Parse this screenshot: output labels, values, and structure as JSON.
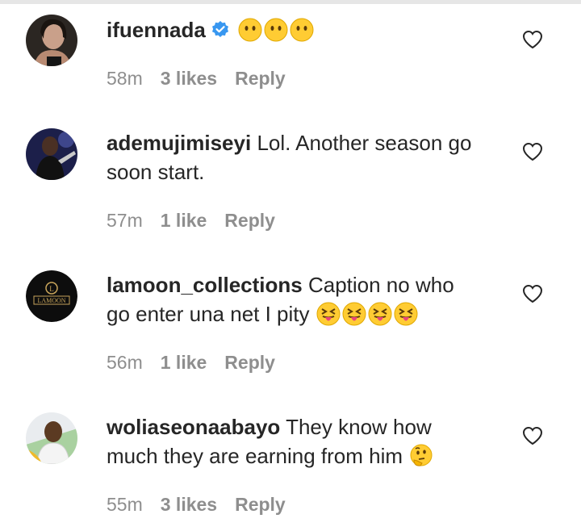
{
  "comments": [
    {
      "username": "ifuennada",
      "verified": true,
      "text": "",
      "emoji": [
        "neutral-face-emoji",
        "neutral-face-emoji",
        "neutral-face-emoji"
      ],
      "time": "58m",
      "likes": "3 likes",
      "reply": "Reply"
    },
    {
      "username": "ademujimiseyi",
      "verified": false,
      "text_line1": "Lol. Another season go",
      "text_line2": "soon start.",
      "time": "57m",
      "likes": "1 like",
      "reply": "Reply"
    },
    {
      "username": "lamoon_collections",
      "verified": false,
      "text_line1": "Caption no who",
      "text_line2": "go enter una net I pity",
      "emoji": [
        "squinting-tongue-emoji",
        "squinting-tongue-emoji",
        "squinting-tongue-emoji",
        "squinting-tongue-emoji"
      ],
      "time": "56m",
      "likes": "1 like",
      "reply": "Reply",
      "avatar_text": "LAMOON"
    },
    {
      "username": "woliaseonaabayo",
      "verified": false,
      "text_line1": "They know how",
      "text_line2": "much they are earning from him",
      "emoji": [
        "thinking-face-emoji"
      ],
      "time": "55m",
      "likes": "3 likes",
      "reply": "Reply"
    }
  ],
  "colors": {
    "text": "#262626",
    "meta": "#8e8e8e",
    "verified": "#3897f0",
    "emoji": "#ffcc33"
  }
}
